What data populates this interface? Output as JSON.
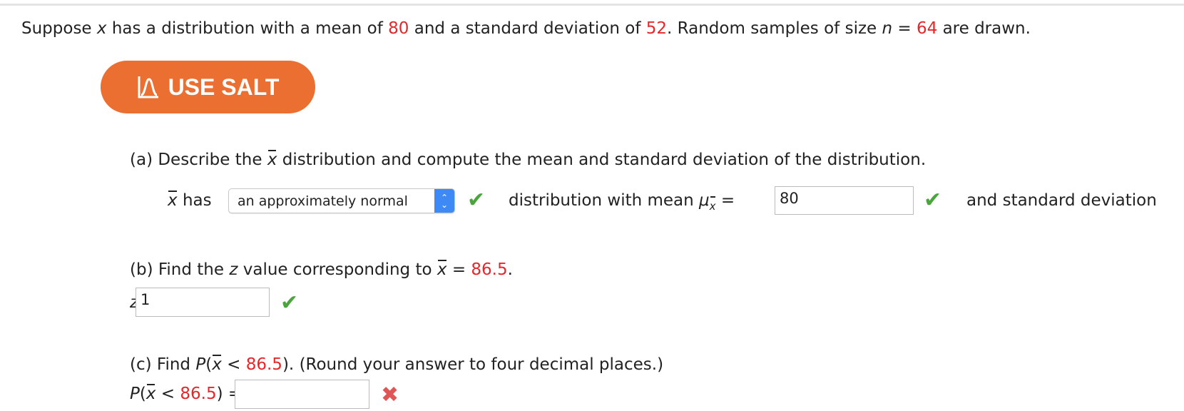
{
  "problem": {
    "prefix": "Suppose",
    "var_x": "x",
    "t1": "has a distribution with a mean of",
    "mean": "80",
    "t2": "and a standard deviation of",
    "sd": "52",
    "t3": ". Random samples of size",
    "var_n": "n",
    "eq": "=",
    "n": "64",
    "t4": "are drawn."
  },
  "salt_button": {
    "label": "USE SALT",
    "icon": "bell-curve-icon",
    "color": "#ea6f30"
  },
  "part_a": {
    "prompt_pre": "(a) Describe the",
    "xbar": "x",
    "prompt_post": "distribution and compute the mean and standard deviation of the distribution.",
    "has": "has",
    "select_value": "an approximately normal",
    "mid_text": "distribution with mean",
    "mu": "μ",
    "mu_sub": "x",
    "eq": "=",
    "mean_value": "80",
    "end_text": "and standard deviation"
  },
  "part_b": {
    "prompt_pre": "(b) Find the",
    "z": "z",
    "prompt_mid": "value corresponding to",
    "xbar": "x",
    "eq": "=",
    "value": "86.5",
    "dot": ".",
    "z_label": "z",
    "z_eq": "=",
    "z_value": "1"
  },
  "part_c": {
    "prompt_pre": "(c) Find",
    "P": "P",
    "open": "(",
    "xbar": "x",
    "lt": "<",
    "value": "86.5",
    "close": ").",
    "note": "(Round your answer to four decimal places.)",
    "ans_close": ") =",
    "answer": ""
  },
  "status_colors": {
    "correct": "#4aa63c",
    "incorrect": "#e05555",
    "highlight": "#e8262a"
  }
}
